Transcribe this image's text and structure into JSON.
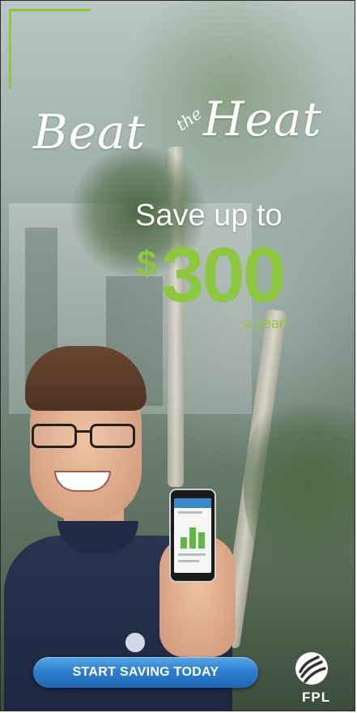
{
  "headline": {
    "word1": "Beat",
    "word2": "the",
    "word3": "Heat"
  },
  "offer": {
    "lead": "Save up to",
    "currency": "$",
    "amount": "300",
    "period": "a year!"
  },
  "cta": {
    "label": "START SAVING TODAY"
  },
  "brand": {
    "name": "FPL",
    "logo_icon": "fpl-logo-icon"
  },
  "colors": {
    "accent_green": "#8dc63f",
    "cta_blue": "#2d7fcf",
    "text_white": "#ffffff"
  }
}
